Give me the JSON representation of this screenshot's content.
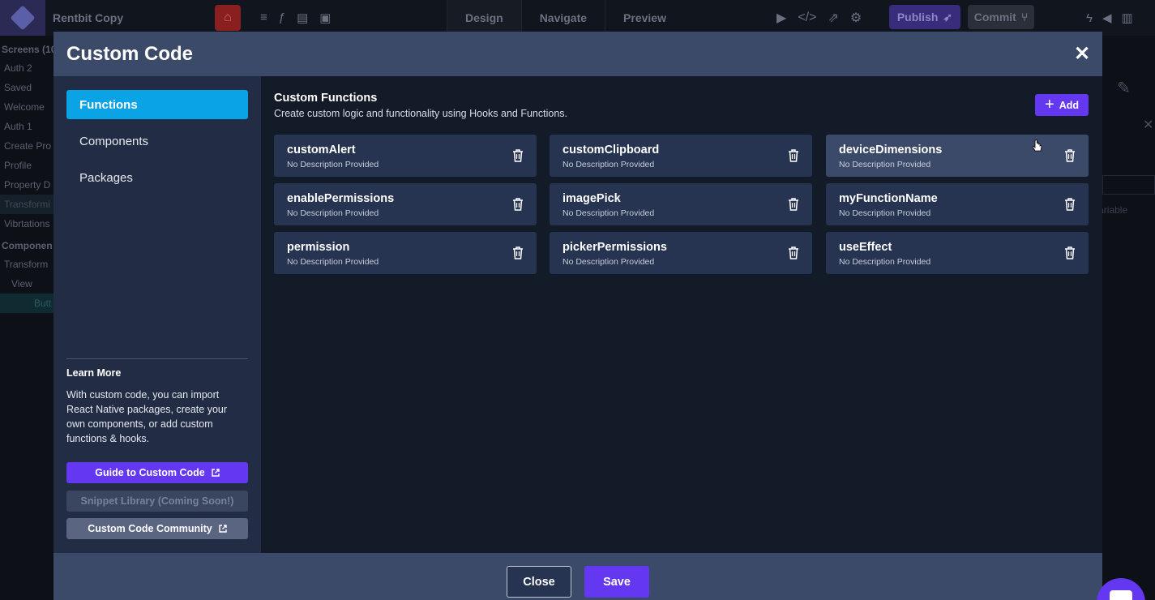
{
  "app": {
    "project_name": "Rentbit Copy",
    "mode_tabs": [
      {
        "label": "Design"
      },
      {
        "label": "Navigate"
      },
      {
        "label": "Preview"
      }
    ],
    "publish_label": "Publish",
    "commit_label": "Commit"
  },
  "left_panel": {
    "screens_header": "Screens (10",
    "screens": [
      "Auth 2",
      "Saved",
      "Welcome",
      "Auth 1",
      "Create Pro",
      "Profile",
      "Property D",
      "Transformi",
      "Vibrtations"
    ],
    "components_header": "Componen",
    "tree": [
      "Transform",
      "View",
      "Butt"
    ]
  },
  "right_panel": {
    "variable_label": "Variable"
  },
  "modal": {
    "title": "Custom Code",
    "close_icon": "close-icon",
    "nav": [
      {
        "label": "Functions",
        "active": true
      },
      {
        "label": "Components",
        "active": false
      },
      {
        "label": "Packages",
        "active": false
      }
    ],
    "learn_more": {
      "title": "Learn More",
      "text": "With custom code, you can import React Native packages, create your own components, or add custom functions & hooks."
    },
    "buttons": {
      "guide": "Guide to Custom Code",
      "snippet": "Snippet Library (Coming Soon!)",
      "community": "Custom Code Community"
    },
    "content": {
      "title": "Custom Functions",
      "subtitle": "Create custom logic and functionality using Hooks and Functions.",
      "add_label": "Add"
    },
    "functions": [
      {
        "name": "customAlert",
        "description": "No Description Provided"
      },
      {
        "name": "customClipboard",
        "description": "No Description Provided"
      },
      {
        "name": "deviceDimensions",
        "description": "No Description Provided"
      },
      {
        "name": "enablePermissions",
        "description": "No Description Provided"
      },
      {
        "name": "imagePick",
        "description": "No Description Provided"
      },
      {
        "name": "myFunctionName",
        "description": "No Description Provided"
      },
      {
        "name": "permission",
        "description": "No Description Provided"
      },
      {
        "name": "pickerPermissions",
        "description": "No Description Provided"
      },
      {
        "name": "useEffect",
        "description": "No Description Provided"
      }
    ],
    "footer": {
      "close_label": "Close",
      "save_label": "Save"
    }
  },
  "colors": {
    "accent": "#6438f0",
    "active_nav": "#0aa3e6",
    "header": "#3c4a69",
    "card": "#263451"
  }
}
